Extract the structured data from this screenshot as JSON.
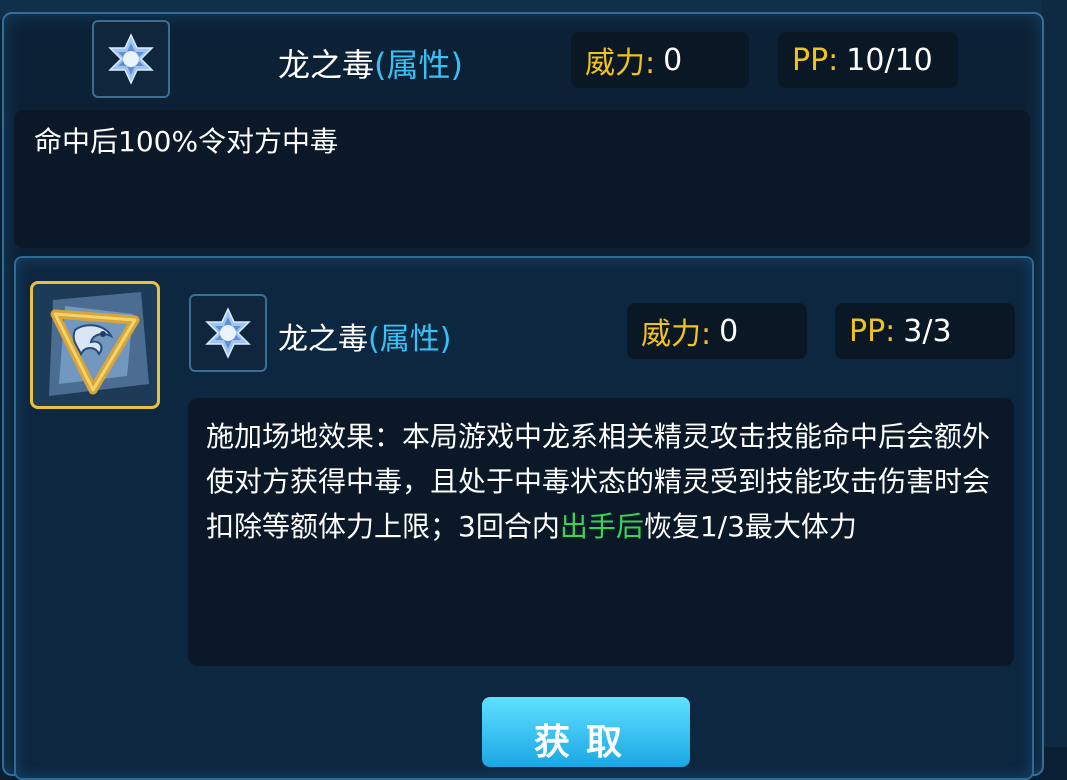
{
  "header": {
    "skill_name": "龙之毒",
    "category": "(属性)",
    "power_label": "威力:",
    "power_value": "0",
    "pp_label": "PP:",
    "pp_value": "10/10",
    "description": "命中后100%令对方中毒",
    "type_icon": "star-crystal-icon"
  },
  "detail": {
    "skill_icon": "dragon-poison-emblem-icon",
    "type_icon": "star-crystal-icon",
    "skill_name": "龙之毒",
    "category": "(属性)",
    "power_label": "威力:",
    "power_value": "0",
    "pp_label": "PP:",
    "pp_value": "3/3",
    "description_part1": "施加场地效果：本局游戏中龙系相关精灵攻击技能命中后会额外使对方获得中毒，且处于中毒状态的精灵受到技能攻击伤害时会扣除等额体力上限；3回合内",
    "description_highlight": "出手后",
    "description_part2": "恢复1/3最大体力",
    "highlight_color": "#39d35a"
  },
  "button": {
    "label": "获取"
  },
  "colors": {
    "label_gold": "#f2c21b",
    "category_blue": "#36c2f4",
    "panel_border": "#2f6f9a"
  }
}
